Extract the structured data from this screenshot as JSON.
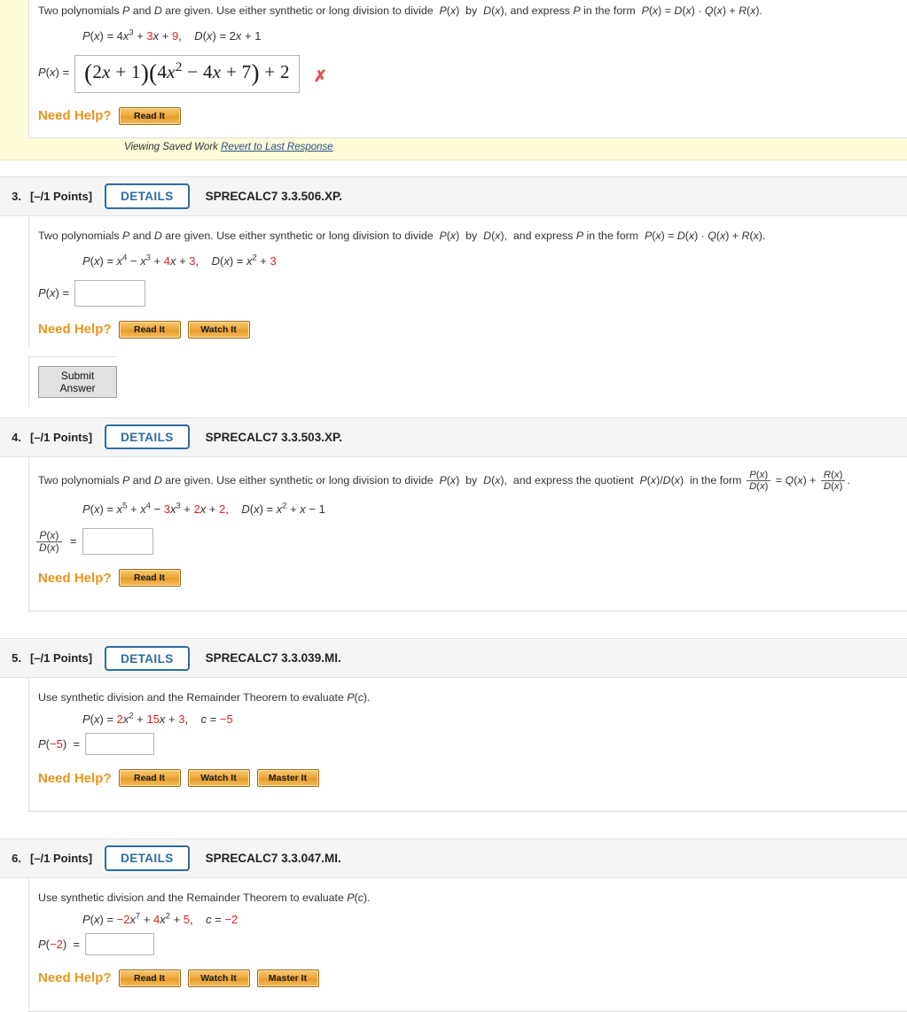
{
  "saved_question": {
    "prompt_parts": {
      "a": "Two polynomials ",
      "P": "P",
      "b": " and ",
      "D": "D",
      "c": " are given. Use either synthetic or long division to divide ",
      "pofx": "P(x)",
      "d": " by ",
      "dofx": "D(x),",
      "e": " and express ",
      "P2": "P",
      "f": " in the form ",
      "form": "P(x) = D(x) · Q(x) + R(x)."
    },
    "given_px_label": "P(x) = ",
    "given_px": "4x3 + 3x + 9,",
    "given_dx": "D(x) = 2x + 1",
    "answer_label": "P(x) =",
    "answer_value": "(2x + 1)(4x2 − 4x + 7) + 2",
    "mark": "✗",
    "need_help_label": "Need Help?",
    "buttons": [
      "Read It"
    ],
    "saved_text": "Viewing Saved Work",
    "revert_link": "Revert to Last Response"
  },
  "questions": [
    {
      "number": "3.",
      "points": "[–/1 Points]",
      "details_label": "DETAILS",
      "code": "SPRECALC7 3.3.506.XP.",
      "prompt": "Two polynomials P and D are given. Use either synthetic or long division to divide  P(x)  by  D(x),  and express P in the form  P(x) = D(x) · Q(x) + R(x).",
      "equation": "P(x) = x4 − x3 + 4x + 3,    D(x) = x2 + 3",
      "answer_label": "P(x) =",
      "answer_value": "",
      "need_help_label": "Need Help?",
      "buttons": [
        "Read It",
        "Watch It"
      ],
      "submit_label": "Submit Answer"
    },
    {
      "number": "4.",
      "points": "[–/1 Points]",
      "details_label": "DETAILS",
      "code": "SPRECALC7 3.3.503.XP.",
      "prompt": "Two polynomials P and D are given. Use either synthetic or long division to divide  P(x)  by  D(x),  and express the quotient  P(x)/D(x)  in the form",
      "equation": "P(x) = x5 + x4 − 3x3 + 2x + 2,    D(x) = x2 + x − 1",
      "answer_label": "P(x)/D(x) =",
      "answer_value": "",
      "need_help_label": "Need Help?",
      "buttons": [
        "Read It"
      ]
    },
    {
      "number": "5.",
      "points": "[–/1 Points]",
      "details_label": "DETAILS",
      "code": "SPRECALC7 3.3.039.MI.",
      "prompt": "Use synthetic division and the Remainder Theorem to evaluate P(c).",
      "equation": "P(x) = 2x2 + 15x + 3,    c = −5",
      "answer_label": "P(−5)  =",
      "answer_value": "",
      "need_help_label": "Need Help?",
      "buttons": [
        "Read It",
        "Watch It",
        "Master It"
      ]
    },
    {
      "number": "6.",
      "points": "[–/1 Points]",
      "details_label": "DETAILS",
      "code": "SPRECALC7 3.3.047.MI.",
      "prompt": "Use synthetic division and the Remainder Theorem to evaluate P(c).",
      "equation": "P(x) = −2x7 + 4x2 + 5,    c = −2",
      "answer_label": "P(−2)  =",
      "answer_value": "",
      "need_help_label": "Need Help?",
      "buttons": [
        "Read It",
        "Watch It",
        "Master It"
      ]
    }
  ],
  "colors": {
    "accent_blue": "#2d6ca2",
    "need_help_orange": "#e8951b",
    "red_value": "#e02020",
    "saved_yellow": "#fdfbd8",
    "header_gray": "#f5f5f5"
  }
}
